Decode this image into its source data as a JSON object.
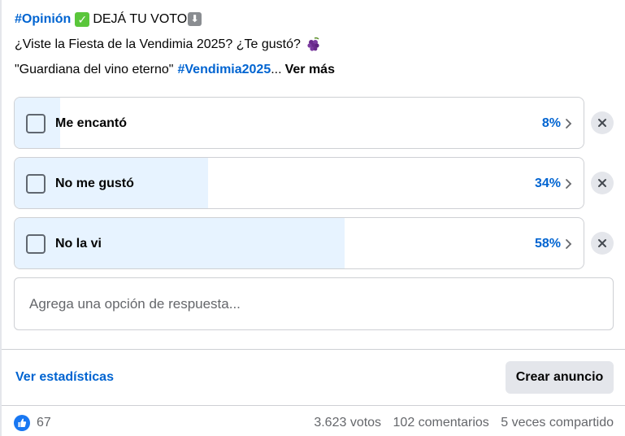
{
  "post": {
    "hashtag_opinion": "#Opinión",
    "vote_call": "DEJÁ TU VOTO",
    "question": "¿Viste la Fiesta de la Vendimia 2025? ¿Te gustó?",
    "quote": "\"Guardiana del vino eterno\"",
    "hashtag_vendimia": "#Vendimia2025",
    "ellipsis": "...",
    "see_more": "Ver más",
    "emojis": [
      "check-mark-emoji",
      "down-arrow-emoji",
      "grapes-emoji"
    ]
  },
  "poll": {
    "options": [
      {
        "label": "Me encantó",
        "percent": "8%",
        "share": 0.08
      },
      {
        "label": "No me gustó",
        "percent": "34%",
        "share": 0.34
      },
      {
        "label": "No la vi",
        "percent": "58%",
        "share": 0.58
      }
    ],
    "add_option_placeholder": "Agrega una opción de respuesta..."
  },
  "actions": {
    "stats_link": "Ver estadísticas",
    "ad_button": "Crear anuncio"
  },
  "footer": {
    "likes": "67",
    "votes": "3.623 votos",
    "comments": "102 comentarios",
    "shares": "5 veces compartido"
  },
  "colors": {
    "link": "#0064d1",
    "poll_fill": "#e7f3ff",
    "border": "#ced0d4",
    "button_bg": "#e4e6eb",
    "like_blue": "#1877f2",
    "secondary_text": "#65676b"
  }
}
